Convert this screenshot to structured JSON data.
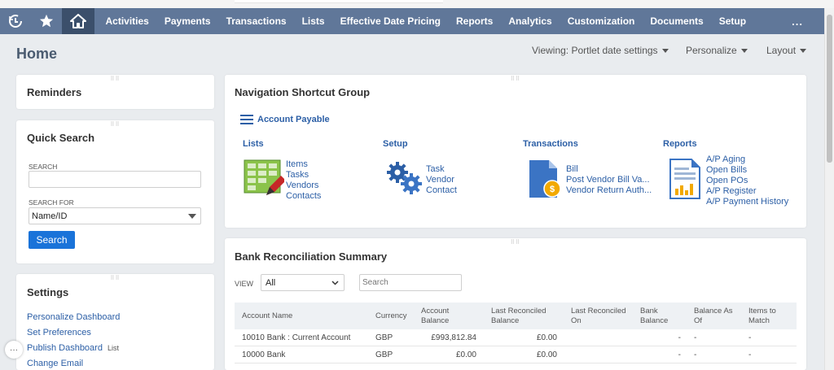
{
  "nav": {
    "items": [
      "Activities",
      "Payments",
      "Transactions",
      "Lists",
      "Effective Date Pricing",
      "Reports",
      "Analytics",
      "Customization",
      "Documents",
      "Setup"
    ],
    "more": "..."
  },
  "page": {
    "title": "Home",
    "viewing": "Viewing: Portlet date settings",
    "personalize": "Personalize",
    "layout": "Layout"
  },
  "reminders": {
    "title": "Reminders"
  },
  "quick_search": {
    "title": "Quick Search",
    "search_label": "SEARCH",
    "search_value": "",
    "search_for_label": "SEARCH FOR",
    "search_for_value": "Name/ID",
    "button": "Search"
  },
  "settings": {
    "title": "Settings",
    "links": [
      "Personalize Dashboard",
      "Set Preferences",
      "Publish Dashboard",
      "Change Email"
    ],
    "publish_badge": "List"
  },
  "shortcuts": {
    "title": "Navigation Shortcut Group",
    "group": "Account Payable",
    "columns": [
      {
        "heading": "Lists",
        "links": [
          "Items",
          "Tasks",
          "Vendors",
          "Contacts"
        ]
      },
      {
        "heading": "Setup",
        "links": [
          "Task",
          "Vendor",
          "Contact"
        ]
      },
      {
        "heading": "Transactions",
        "links": [
          "Bill",
          "Post Vendor Bill Va...",
          "Vendor Return Auth..."
        ]
      },
      {
        "heading": "Reports",
        "links": [
          "A/P Aging",
          "Open Bills",
          "Open POs",
          "A/P Register",
          "A/P Payment History"
        ]
      }
    ]
  },
  "bank": {
    "title": "Bank Reconciliation Summary",
    "view_label": "VIEW",
    "view_value": "All",
    "search_placeholder": "Search",
    "headers": [
      "Account Name",
      "Currency",
      "Account Balance",
      "Last Reconciled Balance",
      "Last Reconciled On",
      "Bank Balance",
      "Balance As Of",
      "Items to Match"
    ],
    "rows": [
      [
        "10010 Bank : Current Account",
        "GBP",
        "£993,812.84",
        "£0.00",
        "",
        "-",
        "-",
        "-"
      ],
      [
        "10000 Bank",
        "GBP",
        "£0.00",
        "£0.00",
        "",
        "-",
        "-",
        "-"
      ]
    ]
  },
  "floating_button": "···",
  "colors": {
    "navbar": "#607799",
    "navbar_active": "#3b4f6b",
    "link": "#2c5fa6",
    "button": "#1a73d9"
  }
}
